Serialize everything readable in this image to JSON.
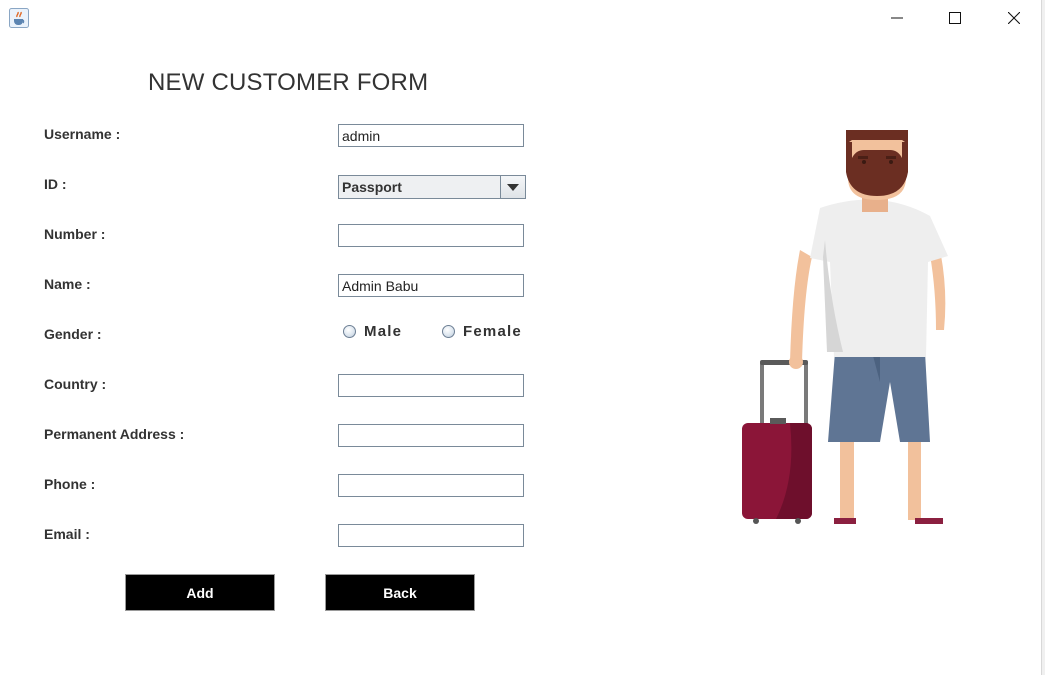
{
  "window": {
    "icons": {
      "app": "java-cup-icon",
      "minimize": "minimize-icon",
      "maximize": "maximize-icon",
      "close": "close-icon"
    }
  },
  "form": {
    "title": "NEW CUSTOMER FORM",
    "labels": {
      "username": "Username :",
      "id": "ID :",
      "number": "Number :",
      "name": "Name :",
      "gender": "Gender :",
      "country": "Country :",
      "address": "Permanent Address :",
      "phone": "Phone :",
      "email": "Email :"
    },
    "values": {
      "username": "admin",
      "id_type": "Passport",
      "number": "",
      "name": "Admin Babu",
      "country": "",
      "address": "",
      "phone": "",
      "email": ""
    },
    "gender_options": {
      "male": "Male",
      "female": "Female"
    },
    "buttons": {
      "add": "Add",
      "back": "Back"
    }
  },
  "illustration": {
    "subject": "traveler-with-suitcase-illustration"
  },
  "colors": {
    "button_bg": "#000000",
    "button_text": "#ffffff",
    "suitcase": "#8b1538",
    "shorts": "#5f7594",
    "shirt": "#eeeeee"
  }
}
